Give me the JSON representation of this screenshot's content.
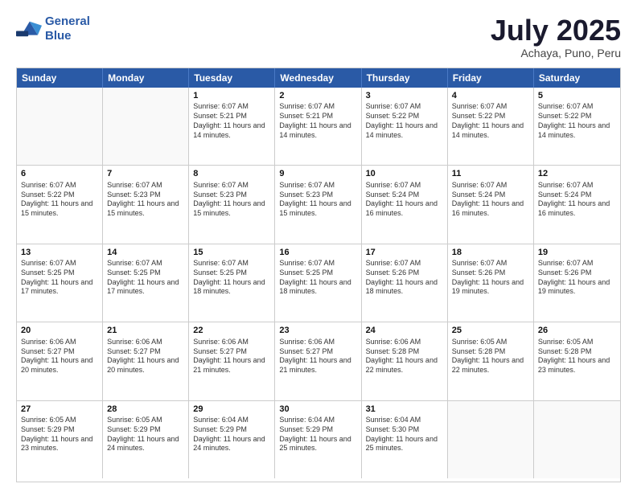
{
  "header": {
    "logo_line1": "General",
    "logo_line2": "Blue",
    "month": "July 2025",
    "location": "Achaya, Puno, Peru"
  },
  "days_of_week": [
    "Sunday",
    "Monday",
    "Tuesday",
    "Wednesday",
    "Thursday",
    "Friday",
    "Saturday"
  ],
  "weeks": [
    [
      {
        "day": "",
        "sunrise": "",
        "sunset": "",
        "daylight": ""
      },
      {
        "day": "",
        "sunrise": "",
        "sunset": "",
        "daylight": ""
      },
      {
        "day": "1",
        "sunrise": "Sunrise: 6:07 AM",
        "sunset": "Sunset: 5:21 PM",
        "daylight": "Daylight: 11 hours and 14 minutes."
      },
      {
        "day": "2",
        "sunrise": "Sunrise: 6:07 AM",
        "sunset": "Sunset: 5:21 PM",
        "daylight": "Daylight: 11 hours and 14 minutes."
      },
      {
        "day": "3",
        "sunrise": "Sunrise: 6:07 AM",
        "sunset": "Sunset: 5:22 PM",
        "daylight": "Daylight: 11 hours and 14 minutes."
      },
      {
        "day": "4",
        "sunrise": "Sunrise: 6:07 AM",
        "sunset": "Sunset: 5:22 PM",
        "daylight": "Daylight: 11 hours and 14 minutes."
      },
      {
        "day": "5",
        "sunrise": "Sunrise: 6:07 AM",
        "sunset": "Sunset: 5:22 PM",
        "daylight": "Daylight: 11 hours and 14 minutes."
      }
    ],
    [
      {
        "day": "6",
        "sunrise": "Sunrise: 6:07 AM",
        "sunset": "Sunset: 5:22 PM",
        "daylight": "Daylight: 11 hours and 15 minutes."
      },
      {
        "day": "7",
        "sunrise": "Sunrise: 6:07 AM",
        "sunset": "Sunset: 5:23 PM",
        "daylight": "Daylight: 11 hours and 15 minutes."
      },
      {
        "day": "8",
        "sunrise": "Sunrise: 6:07 AM",
        "sunset": "Sunset: 5:23 PM",
        "daylight": "Daylight: 11 hours and 15 minutes."
      },
      {
        "day": "9",
        "sunrise": "Sunrise: 6:07 AM",
        "sunset": "Sunset: 5:23 PM",
        "daylight": "Daylight: 11 hours and 15 minutes."
      },
      {
        "day": "10",
        "sunrise": "Sunrise: 6:07 AM",
        "sunset": "Sunset: 5:24 PM",
        "daylight": "Daylight: 11 hours and 16 minutes."
      },
      {
        "day": "11",
        "sunrise": "Sunrise: 6:07 AM",
        "sunset": "Sunset: 5:24 PM",
        "daylight": "Daylight: 11 hours and 16 minutes."
      },
      {
        "day": "12",
        "sunrise": "Sunrise: 6:07 AM",
        "sunset": "Sunset: 5:24 PM",
        "daylight": "Daylight: 11 hours and 16 minutes."
      }
    ],
    [
      {
        "day": "13",
        "sunrise": "Sunrise: 6:07 AM",
        "sunset": "Sunset: 5:25 PM",
        "daylight": "Daylight: 11 hours and 17 minutes."
      },
      {
        "day": "14",
        "sunrise": "Sunrise: 6:07 AM",
        "sunset": "Sunset: 5:25 PM",
        "daylight": "Daylight: 11 hours and 17 minutes."
      },
      {
        "day": "15",
        "sunrise": "Sunrise: 6:07 AM",
        "sunset": "Sunset: 5:25 PM",
        "daylight": "Daylight: 11 hours and 18 minutes."
      },
      {
        "day": "16",
        "sunrise": "Sunrise: 6:07 AM",
        "sunset": "Sunset: 5:25 PM",
        "daylight": "Daylight: 11 hours and 18 minutes."
      },
      {
        "day": "17",
        "sunrise": "Sunrise: 6:07 AM",
        "sunset": "Sunset: 5:26 PM",
        "daylight": "Daylight: 11 hours and 18 minutes."
      },
      {
        "day": "18",
        "sunrise": "Sunrise: 6:07 AM",
        "sunset": "Sunset: 5:26 PM",
        "daylight": "Daylight: 11 hours and 19 minutes."
      },
      {
        "day": "19",
        "sunrise": "Sunrise: 6:07 AM",
        "sunset": "Sunset: 5:26 PM",
        "daylight": "Daylight: 11 hours and 19 minutes."
      }
    ],
    [
      {
        "day": "20",
        "sunrise": "Sunrise: 6:06 AM",
        "sunset": "Sunset: 5:27 PM",
        "daylight": "Daylight: 11 hours and 20 minutes."
      },
      {
        "day": "21",
        "sunrise": "Sunrise: 6:06 AM",
        "sunset": "Sunset: 5:27 PM",
        "daylight": "Daylight: 11 hours and 20 minutes."
      },
      {
        "day": "22",
        "sunrise": "Sunrise: 6:06 AM",
        "sunset": "Sunset: 5:27 PM",
        "daylight": "Daylight: 11 hours and 21 minutes."
      },
      {
        "day": "23",
        "sunrise": "Sunrise: 6:06 AM",
        "sunset": "Sunset: 5:27 PM",
        "daylight": "Daylight: 11 hours and 21 minutes."
      },
      {
        "day": "24",
        "sunrise": "Sunrise: 6:06 AM",
        "sunset": "Sunset: 5:28 PM",
        "daylight": "Daylight: 11 hours and 22 minutes."
      },
      {
        "day": "25",
        "sunrise": "Sunrise: 6:05 AM",
        "sunset": "Sunset: 5:28 PM",
        "daylight": "Daylight: 11 hours and 22 minutes."
      },
      {
        "day": "26",
        "sunrise": "Sunrise: 6:05 AM",
        "sunset": "Sunset: 5:28 PM",
        "daylight": "Daylight: 11 hours and 23 minutes."
      }
    ],
    [
      {
        "day": "27",
        "sunrise": "Sunrise: 6:05 AM",
        "sunset": "Sunset: 5:29 PM",
        "daylight": "Daylight: 11 hours and 23 minutes."
      },
      {
        "day": "28",
        "sunrise": "Sunrise: 6:05 AM",
        "sunset": "Sunset: 5:29 PM",
        "daylight": "Daylight: 11 hours and 24 minutes."
      },
      {
        "day": "29",
        "sunrise": "Sunrise: 6:04 AM",
        "sunset": "Sunset: 5:29 PM",
        "daylight": "Daylight: 11 hours and 24 minutes."
      },
      {
        "day": "30",
        "sunrise": "Sunrise: 6:04 AM",
        "sunset": "Sunset: 5:29 PM",
        "daylight": "Daylight: 11 hours and 25 minutes."
      },
      {
        "day": "31",
        "sunrise": "Sunrise: 6:04 AM",
        "sunset": "Sunset: 5:30 PM",
        "daylight": "Daylight: 11 hours and 25 minutes."
      },
      {
        "day": "",
        "sunrise": "",
        "sunset": "",
        "daylight": ""
      },
      {
        "day": "",
        "sunrise": "",
        "sunset": "",
        "daylight": ""
      }
    ]
  ]
}
